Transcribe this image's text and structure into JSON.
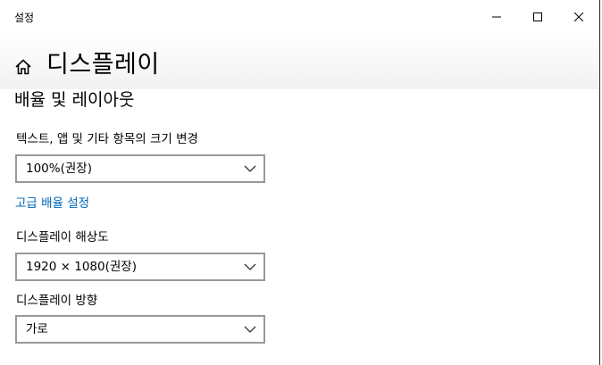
{
  "window": {
    "title": "설정"
  },
  "header": {
    "title": "디스플레이"
  },
  "section": {
    "title": "배율 및 레이아웃"
  },
  "scale": {
    "label": "텍스트, 앱 및 기타 항목의 크기 변경",
    "value": "100%(권장)"
  },
  "advanced_scaling_link": "고급 배율 설정",
  "resolution": {
    "label": "디스플레이 해상도",
    "value": "1920 × 1080(권장)"
  },
  "orientation": {
    "label": "디스플레이 방향",
    "value": "가로"
  },
  "colors": {
    "link": "#0067b8",
    "dropdown_border": "#999999"
  },
  "icons": {
    "home": "home-icon",
    "minimize": "minimize-icon",
    "maximize": "maximize-icon",
    "close": "close-icon",
    "dropdown": "chevron-down-icon"
  }
}
